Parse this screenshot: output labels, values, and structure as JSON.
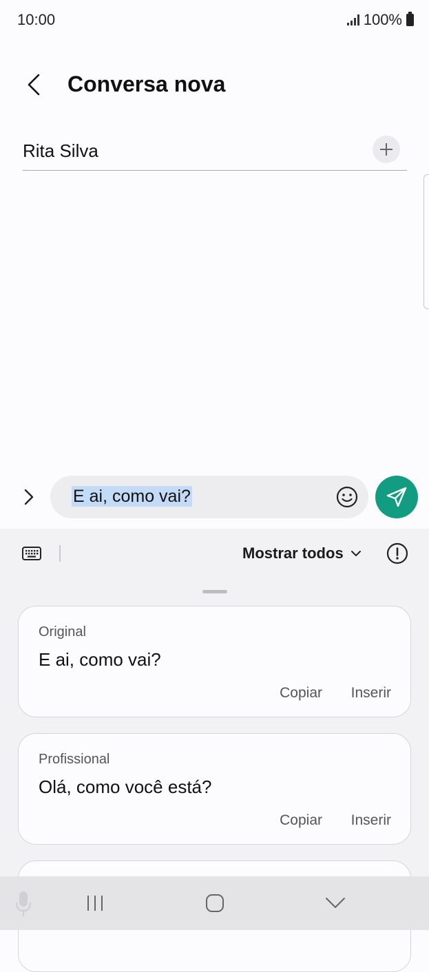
{
  "status_bar": {
    "time": "10:00",
    "battery": "100%"
  },
  "header": {
    "title": "Conversa nova"
  },
  "recipient": {
    "name": "Rita Silva"
  },
  "composer": {
    "message": "E ai, como vai?"
  },
  "suggestions_panel": {
    "show_all_label": "Mostrar todos",
    "cards": [
      {
        "label": "Original",
        "text": "E ai, como vai?",
        "copy": "Copiar",
        "insert": "Inserir"
      },
      {
        "label": "Profissional",
        "text": "Olá, como você está?",
        "copy": "Copiar",
        "insert": "Inserir"
      }
    ]
  },
  "colors": {
    "accent": "#129c81",
    "selection": "#c4dbf7"
  }
}
